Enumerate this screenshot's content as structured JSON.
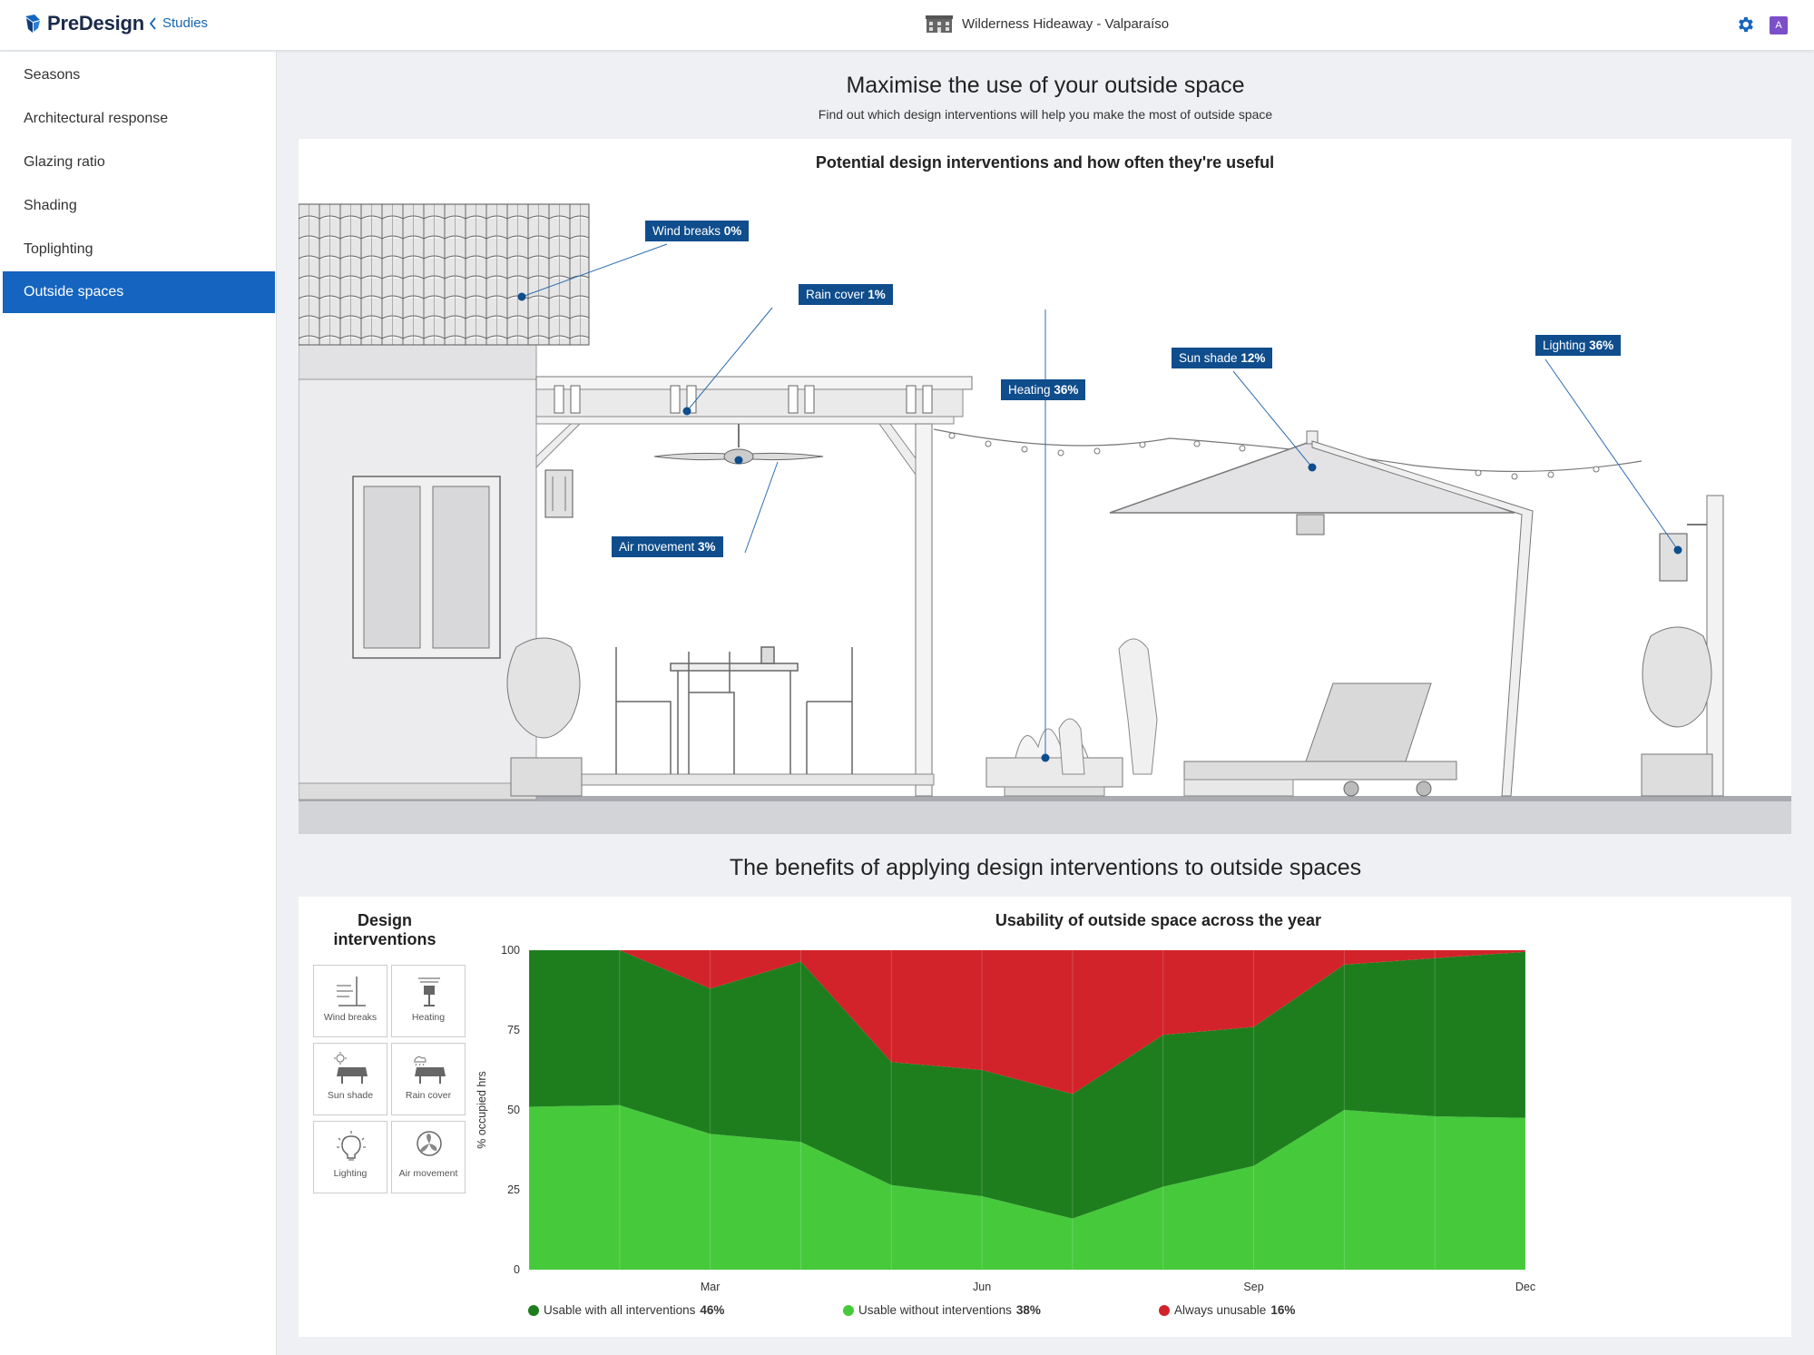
{
  "app": {
    "logo_text": "PreDesign",
    "back_label": "Studies",
    "project_name": "Wilderness Hideaway - Valparaíso",
    "avatar_letter": "A"
  },
  "sidebar": {
    "items": [
      {
        "label": "Seasons",
        "active": false
      },
      {
        "label": "Architectural response",
        "active": false
      },
      {
        "label": "Glazing ratio",
        "active": false
      },
      {
        "label": "Shading",
        "active": false
      },
      {
        "label": "Toplighting",
        "active": false
      },
      {
        "label": "Outside spaces",
        "active": true
      }
    ]
  },
  "main": {
    "title": "Maximise the use of your outside space",
    "subtitle": "Find out which design interventions will help you make the most of outside space",
    "illustration_title": "Potential design interventions and how often they're useful",
    "tags": [
      {
        "label": "Wind breaks",
        "value": "0%"
      },
      {
        "label": "Rain cover",
        "value": "1%"
      },
      {
        "label": "Heating",
        "value": "36%"
      },
      {
        "label": "Sun shade",
        "value": "12%"
      },
      {
        "label": "Lighting",
        "value": "36%"
      },
      {
        "label": "Air movement",
        "value": "3%"
      }
    ],
    "benefits_title": "The benefits of applying design interventions to outside spaces"
  },
  "interventions": {
    "title": "Design interventions",
    "tiles": [
      {
        "label": "Wind breaks",
        "icon": "wind-breaks-icon"
      },
      {
        "label": "Heating",
        "icon": "heating-icon"
      },
      {
        "label": "Sun shade",
        "icon": "sun-shade-icon"
      },
      {
        "label": "Rain cover",
        "icon": "rain-cover-icon"
      },
      {
        "label": "Lighting",
        "icon": "lighting-icon"
      },
      {
        "label": "Air movement",
        "icon": "air-movement-icon"
      }
    ]
  },
  "colors": {
    "accent": "#1565c0",
    "tag": "#0f4d8c",
    "dark_green": "#1e7e1e",
    "light_green": "#47c93c",
    "red": "#d2232a"
  },
  "chart_data": {
    "type": "area",
    "title": "Usability of outside space across the year",
    "ylabel": "% occupied hrs",
    "ylim": [
      0,
      100
    ],
    "yticks": [
      0,
      25,
      50,
      75,
      100
    ],
    "x": [
      "Jan",
      "Feb",
      "Mar",
      "Apr",
      "May",
      "Jun",
      "Jul",
      "Aug",
      "Sep",
      "Oct",
      "Nov",
      "Dec"
    ],
    "xtick_labels": [
      "Mar",
      "Jun",
      "Sep",
      "Dec"
    ],
    "stacked": true,
    "series": [
      {
        "name": "Usable without interventions",
        "summary": "38%",
        "color": "#47c93c",
        "values": [
          51,
          51.5,
          42.5,
          40,
          26.5,
          23,
          16,
          26,
          32.5,
          50,
          48,
          47.5
        ]
      },
      {
        "name": "Usable with all interventions",
        "summary": "46%",
        "color": "#1e7e1e",
        "values": [
          49,
          48.5,
          45.5,
          56.5,
          38.5,
          39.5,
          39,
          47.5,
          43.5,
          45.5,
          49.5,
          52
        ]
      },
      {
        "name": "Always unusable",
        "summary": "16%",
        "color": "#d2232a",
        "values": [
          0,
          0,
          12,
          3.5,
          35,
          37.5,
          45,
          26.5,
          24,
          4.5,
          2.5,
          0.5
        ]
      }
    ],
    "legend": [
      {
        "name": "Usable with all interventions",
        "value": "46%",
        "color": "#1e7e1e"
      },
      {
        "name": "Usable without interventions",
        "value": "38%",
        "color": "#47c93c"
      },
      {
        "name": "Always unusable",
        "value": "16%",
        "color": "#d2232a"
      }
    ],
    "legend_position": "bottom",
    "grid": true
  }
}
